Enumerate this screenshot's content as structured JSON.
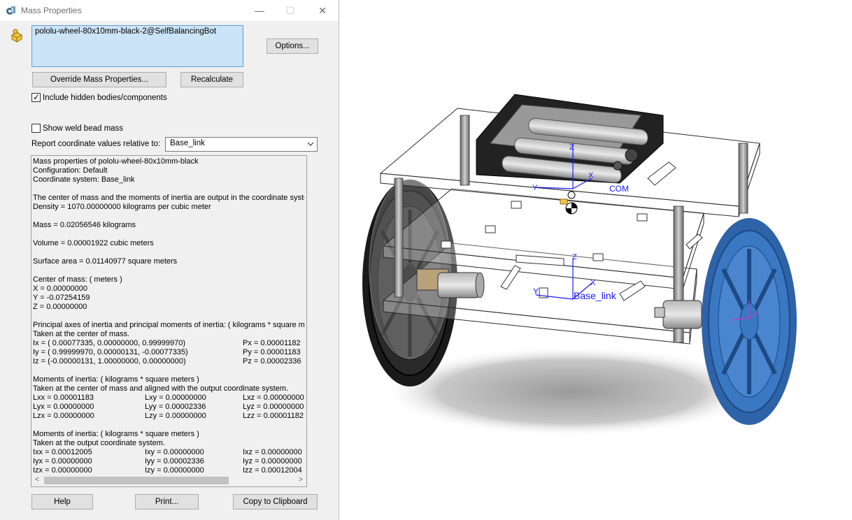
{
  "window": {
    "title": "Mass Properties",
    "min_glyph": "—",
    "max_glyph": "☐",
    "close_glyph": "✕"
  },
  "selection": {
    "text": "pololu-wheel-80x10mm-black-2@SelfBalancingBot"
  },
  "buttons": {
    "options": "Options...",
    "override": "Override Mass Properties...",
    "recalculate": "Recalculate",
    "help": "Help",
    "print": "Print...",
    "copy": "Copy to Clipboard"
  },
  "checkboxes": {
    "include_hidden": {
      "label": "Include hidden bodies/components",
      "checked": true
    },
    "weld_bead": {
      "label": "Show weld bead mass",
      "checked": false
    }
  },
  "report": {
    "label": "Report coordinate values relative to:",
    "value": "Base_link"
  },
  "results": [
    {
      "text": "Mass properties of pololu-wheel-80x10mm-black"
    },
    {
      "text": "     Configuration: Default"
    },
    {
      "text": "     Coordinate system: Base_link"
    },
    {
      "text": ""
    },
    {
      "text": "The center of mass and the moments of inertia are output in the coordinate system of Base_link"
    },
    {
      "text": "Density = 1070.00000000 kilograms per cubic meter"
    },
    {
      "text": ""
    },
    {
      "text": "Mass = 0.02056546 kilograms"
    },
    {
      "text": ""
    },
    {
      "text": "Volume = 0.00001922 cubic meters"
    },
    {
      "text": ""
    },
    {
      "text": "Surface area = 0.01140977 square meters"
    },
    {
      "text": ""
    },
    {
      "text": "Center of mass: ( meters )"
    },
    {
      "text": "     X = 0.00000000"
    },
    {
      "text": "     Y = -0.07254159"
    },
    {
      "text": "     Z = 0.00000000"
    },
    {
      "text": ""
    },
    {
      "text": "Principal axes of inertia and principal moments of inertia: ( kilograms * square meters )"
    },
    {
      "text": "Taken at the center of mass."
    },
    {
      "text": "     Ix = ( 0.00077335,  0.00000000,  0.99999970)",
      "right": "Px = 0.00001182"
    },
    {
      "text": "     Iy = ( 0.99999970,  0.00000131, -0.00077335)",
      "right": "Py = 0.00001183"
    },
    {
      "text": "     Iz = (-0.00000131,  1.00000000,  0.00000000)",
      "right": "Pz = 0.00002336"
    },
    {
      "text": ""
    },
    {
      "text": "Moments of inertia: ( kilograms * square meters )"
    },
    {
      "text": "Taken at the center of mass and aligned with the output coordinate system."
    },
    {
      "text": "     Lxx = 0.00001183",
      "mid": "Lxy = 0.00000000",
      "right": "Lxz = 0.00000000"
    },
    {
      "text": "     Lyx = 0.00000000",
      "mid": "Lyy = 0.00002336",
      "right": "Lyz = 0.00000000"
    },
    {
      "text": "     Lzx = 0.00000000",
      "mid": "Lzy = 0.00000000",
      "right": "Lzz = 0.00001182"
    },
    {
      "text": ""
    },
    {
      "text": "Moments of inertia: ( kilograms * square meters )"
    },
    {
      "text": "Taken at the output coordinate system."
    },
    {
      "text": "     Ixx = 0.00012005",
      "mid": "Ixy = 0.00000000",
      "right": "Ixz = 0.00000000"
    },
    {
      "text": "     Iyx = 0.00000000",
      "mid": "Iyy = 0.00002336",
      "right": "Iyz = 0.00000000"
    },
    {
      "text": "     Izx = 0.00000000",
      "mid": "Izy = 0.00000000",
      "right": "Izz = 0.00012004"
    }
  ],
  "viewport": {
    "labels": {
      "com_label": "COM",
      "base_label": "Base_link",
      "z1": "Z",
      "x1": "X",
      "y1": "Y",
      "z2": "Z",
      "x2": "X",
      "y2": "Y"
    }
  },
  "colors": {
    "selection_bg": "#cce4f7",
    "wheel_blue": "#3b78c3",
    "axis_blue": "#1a1aff"
  },
  "icons": {
    "title": "mass-properties-icon",
    "side": "component-icon",
    "dropdown": "chevron-down-icon"
  }
}
